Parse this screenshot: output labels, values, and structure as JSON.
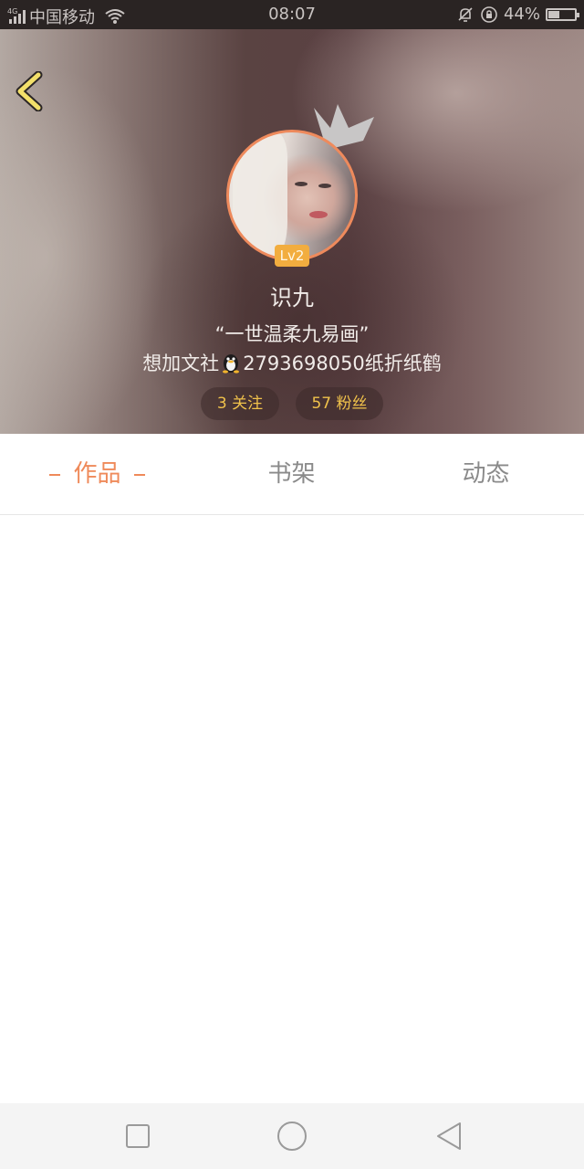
{
  "status_bar": {
    "network": "4G",
    "carrier": "中国移动",
    "time": "08:07",
    "battery": "44%",
    "battery_level": 0.44,
    "icons": [
      "signal-icon",
      "wifi-icon",
      "mute-icon",
      "rotation-lock-icon",
      "battery-icon"
    ]
  },
  "header": {
    "back_icon": "chevron-left-icon",
    "crown_icon": "crown-icon",
    "level": "Lv2",
    "username": "识九",
    "signature": "“一世温柔九易画”",
    "info_prefix": "想加文社",
    "info_icon": "qq-penguin-icon",
    "info_suffix": "2793698050纸折纸鹤",
    "stats": {
      "following": "3 关注",
      "fans": "57 粉丝"
    },
    "colors": {
      "avatar_border": "#ee8a5c",
      "level_badge": "#f2ad3f",
      "stat_text": "#f0c24b"
    }
  },
  "tabs": [
    {
      "label": "作品",
      "active": true
    },
    {
      "label": "书架",
      "active": false
    },
    {
      "label": "动态",
      "active": false
    }
  ],
  "tab_active_color": "#ef8a5a",
  "nav_bar": {
    "icons": [
      "recent-apps-icon",
      "home-icon",
      "back-icon"
    ]
  }
}
